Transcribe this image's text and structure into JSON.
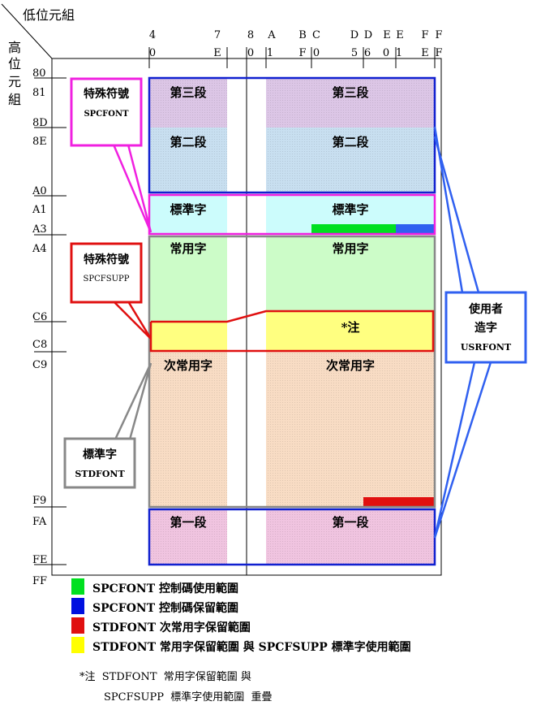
{
  "axis": {
    "low_title": "低位元組",
    "high_title": [
      "高",
      "位",
      "元",
      "組"
    ],
    "top_hex": [
      "4",
      "7",
      "8",
      "A",
      "B",
      "C",
      "D",
      "D",
      "E",
      "E",
      "F",
      "F"
    ],
    "second_hex": [
      "0",
      "E",
      "0",
      "1",
      "F",
      "0",
      "5",
      "6",
      "0",
      "1",
      "E",
      "F"
    ],
    "row_labels": [
      "80",
      "81",
      "8D",
      "8E",
      "A0",
      "A1",
      "A3",
      "A4",
      "C6",
      "C8",
      "C9",
      "F9",
      "FA",
      "FE",
      "FF"
    ]
  },
  "regions": {
    "third": "第三段",
    "second": "第二段",
    "standard": "標準字",
    "common": "常用字",
    "note": "*注",
    "less_common": "次常用字",
    "first": "第一段"
  },
  "callouts": {
    "spcfont": {
      "title": "特殊符號",
      "code": "SPCFONT"
    },
    "spcfsupp": {
      "title": "特殊符號",
      "code": "SPCFSUPP"
    },
    "stdfont": {
      "title": "標準字",
      "code": "STDFONT"
    },
    "usrfont": {
      "line1": "使用者",
      "line2": "造字",
      "code": "USRFONT"
    }
  },
  "legend": [
    {
      "color": "#00e020",
      "text": "SPCFONT  控制碼使用範圍"
    },
    {
      "color": "#0010e0",
      "text": "SPCFONT  控制碼保留範圍"
    },
    {
      "color": "#e01010",
      "text": "STDFONT  次常用字保留範圍"
    },
    {
      "color": "#ffff00",
      "text": "STDFONT  常用字保留範圍 與 SPCFSUPP 標準字使用範圍"
    }
  ],
  "footnote": {
    "line1": "*注  STDFONT  常用字保留範圍 與",
    "line2": "SPCFSUPP  標準字使用範圍  重疊"
  },
  "colors": {
    "purple_fill": "#dcc6e6",
    "blue_fill": "#c8dff0",
    "cyan_fill": "#ccfcfc",
    "green_fill": "#ccfcc8",
    "yellow_fill": "#ffff80",
    "peach_fill": "#f8dcc4",
    "pink_fill": "#f0c4e0",
    "border_blue": "#1020d0",
    "border_magenta": "#f020e0",
    "border_red": "#e01010",
    "border_gray": "#888888",
    "callout_blue": "#3060f0"
  }
}
